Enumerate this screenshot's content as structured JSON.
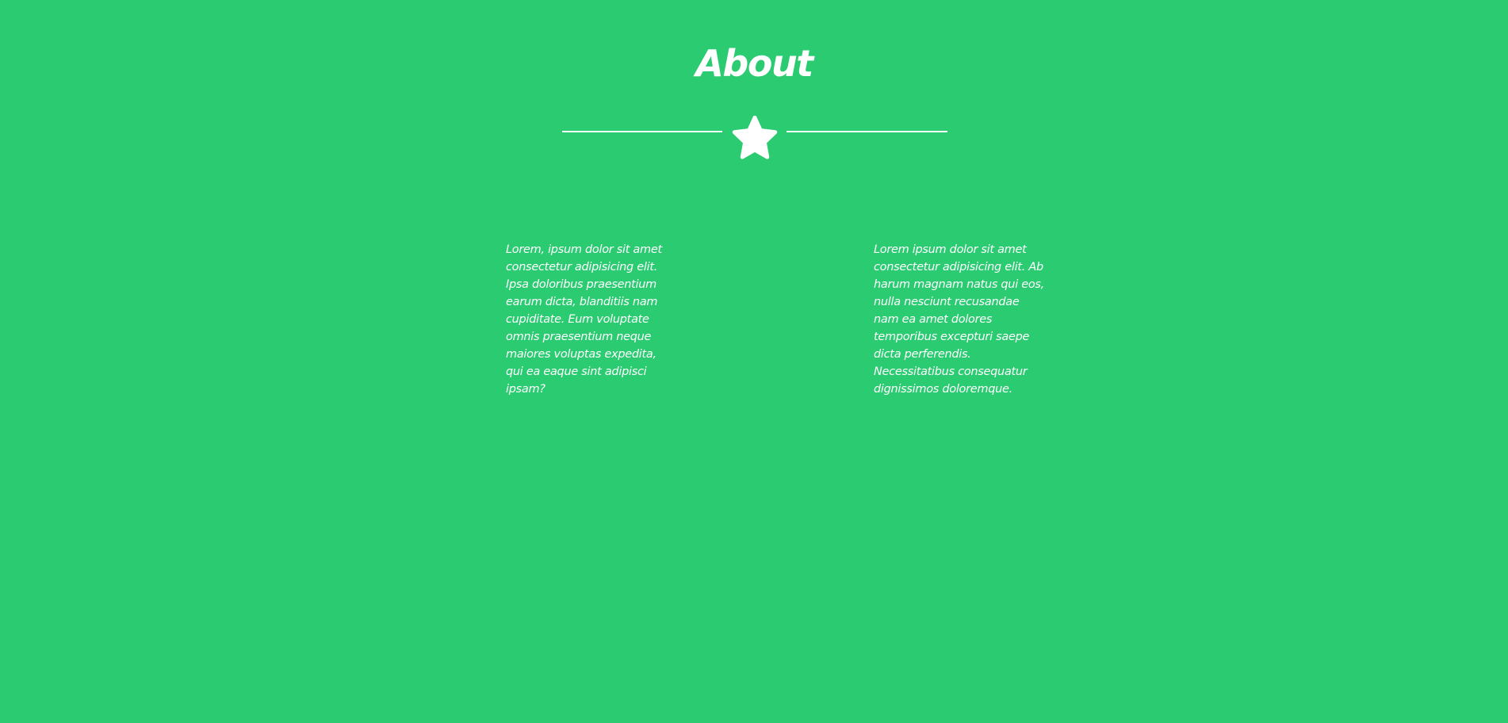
{
  "about": {
    "title": "About",
    "divider_icon": "star-icon",
    "left_paragraph": "Lorem, ipsum dolor sit amet consectetur adipisicing elit. Ipsa doloribus praesentium earum dicta, blanditiis nam cupiditate. Eum voluptate omnis praesentium neque maiores voluptas expedita, qui ea eaque sint adipisci ipsam?",
    "right_paragraph": "Lorem ipsum dolor sit amet consectetur adipisicing elit. Ab harum magnam natus qui eos, nulla nesciunt recusandae nam ea amet dolores temporibus excepturi saepe dicta perferendis. Necessitatibus consequatur dignissimos doloremque."
  },
  "colors": {
    "background": "#2acb71",
    "foreground": "#ffffff"
  }
}
